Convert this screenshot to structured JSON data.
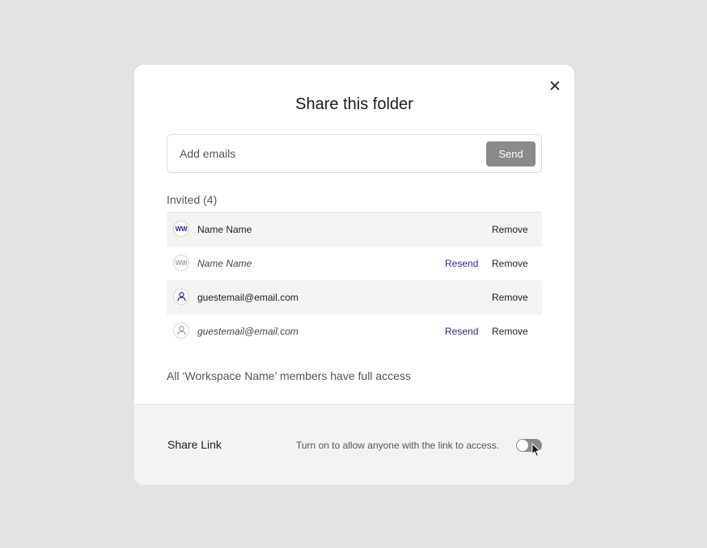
{
  "modal": {
    "title": "Share this folder",
    "close_icon": "close-icon"
  },
  "email_input": {
    "placeholder": "Add emails",
    "value": ""
  },
  "send_button": {
    "label": "Send"
  },
  "invited": {
    "label": "Invited (4)",
    "rows": [
      {
        "initials": "WW",
        "name": "Name Name",
        "status": "active",
        "resend": "",
        "remove": "Remove"
      },
      {
        "initials": "WW",
        "name": "Name Name",
        "status": "pending",
        "resend": "Resend",
        "remove": "Remove"
      },
      {
        "icon": "user-icon",
        "name": "guestemail@email.com",
        "status": "active",
        "resend": "",
        "remove": "Remove"
      },
      {
        "icon": "user-icon",
        "name": "guestemail@email.com",
        "status": "pending",
        "resend": "Resend",
        "remove": "Remove"
      }
    ]
  },
  "workspace_note": "All ‘Workspace Name’ members have full access",
  "share_link": {
    "label": "Share Link",
    "description": "Turn on to allow anyone with the link to access.",
    "enabled": false
  },
  "colors": {
    "accent": "#2d1f8f",
    "send_button_bg": "#8a8a8a",
    "page_bg": "#e2e2e2",
    "footer_bg": "#f3f3f3"
  }
}
